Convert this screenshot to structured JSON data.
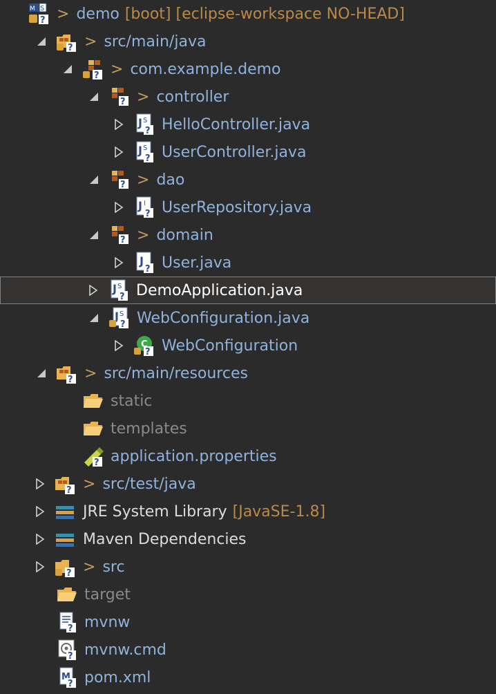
{
  "tree": {
    "project": {
      "prefix": ">",
      "label": "demo",
      "decoration": "[boot] [eclipse-workspace NO-HEAD]"
    },
    "src_main_java": {
      "prefix": ">",
      "label": "src/main/java"
    },
    "pkg_demo": {
      "prefix": ">",
      "label": "com.example.demo"
    },
    "pkg_controller": {
      "prefix": ">",
      "label": "controller"
    },
    "hello_controller": {
      "label": "HelloController.java"
    },
    "user_controller": {
      "label": "UserController.java"
    },
    "pkg_dao": {
      "prefix": ">",
      "label": "dao"
    },
    "user_repository": {
      "label": "UserRepository.java"
    },
    "pkg_domain": {
      "prefix": ">",
      "label": "domain"
    },
    "user_java": {
      "label": "User.java"
    },
    "demo_application": {
      "label": "DemoApplication.java"
    },
    "web_configuration_java": {
      "label": "WebConfiguration.java"
    },
    "web_configuration_class": {
      "label": "WebConfiguration"
    },
    "src_main_resources": {
      "prefix": ">",
      "label": "src/main/resources"
    },
    "static": {
      "label": "static"
    },
    "templates": {
      "label": "templates"
    },
    "application_properties": {
      "label": "application.properties"
    },
    "src_test_java": {
      "prefix": ">",
      "label": "src/test/java"
    },
    "jre_library": {
      "label": "JRE System Library",
      "decoration": "[JavaSE-1.8]"
    },
    "maven_dependencies": {
      "label": "Maven Dependencies"
    },
    "src": {
      "prefix": ">",
      "label": "src"
    },
    "target": {
      "label": "target"
    },
    "mvnw": {
      "label": "mvnw"
    },
    "mvnw_cmd": {
      "label": "mvnw.cmd"
    },
    "pom_xml": {
      "label": "pom.xml"
    }
  },
  "colors": {
    "background": "#2b2b2b",
    "label": "#8fb3dc",
    "decoration": "#b98a48",
    "selected_row": "#343331"
  }
}
